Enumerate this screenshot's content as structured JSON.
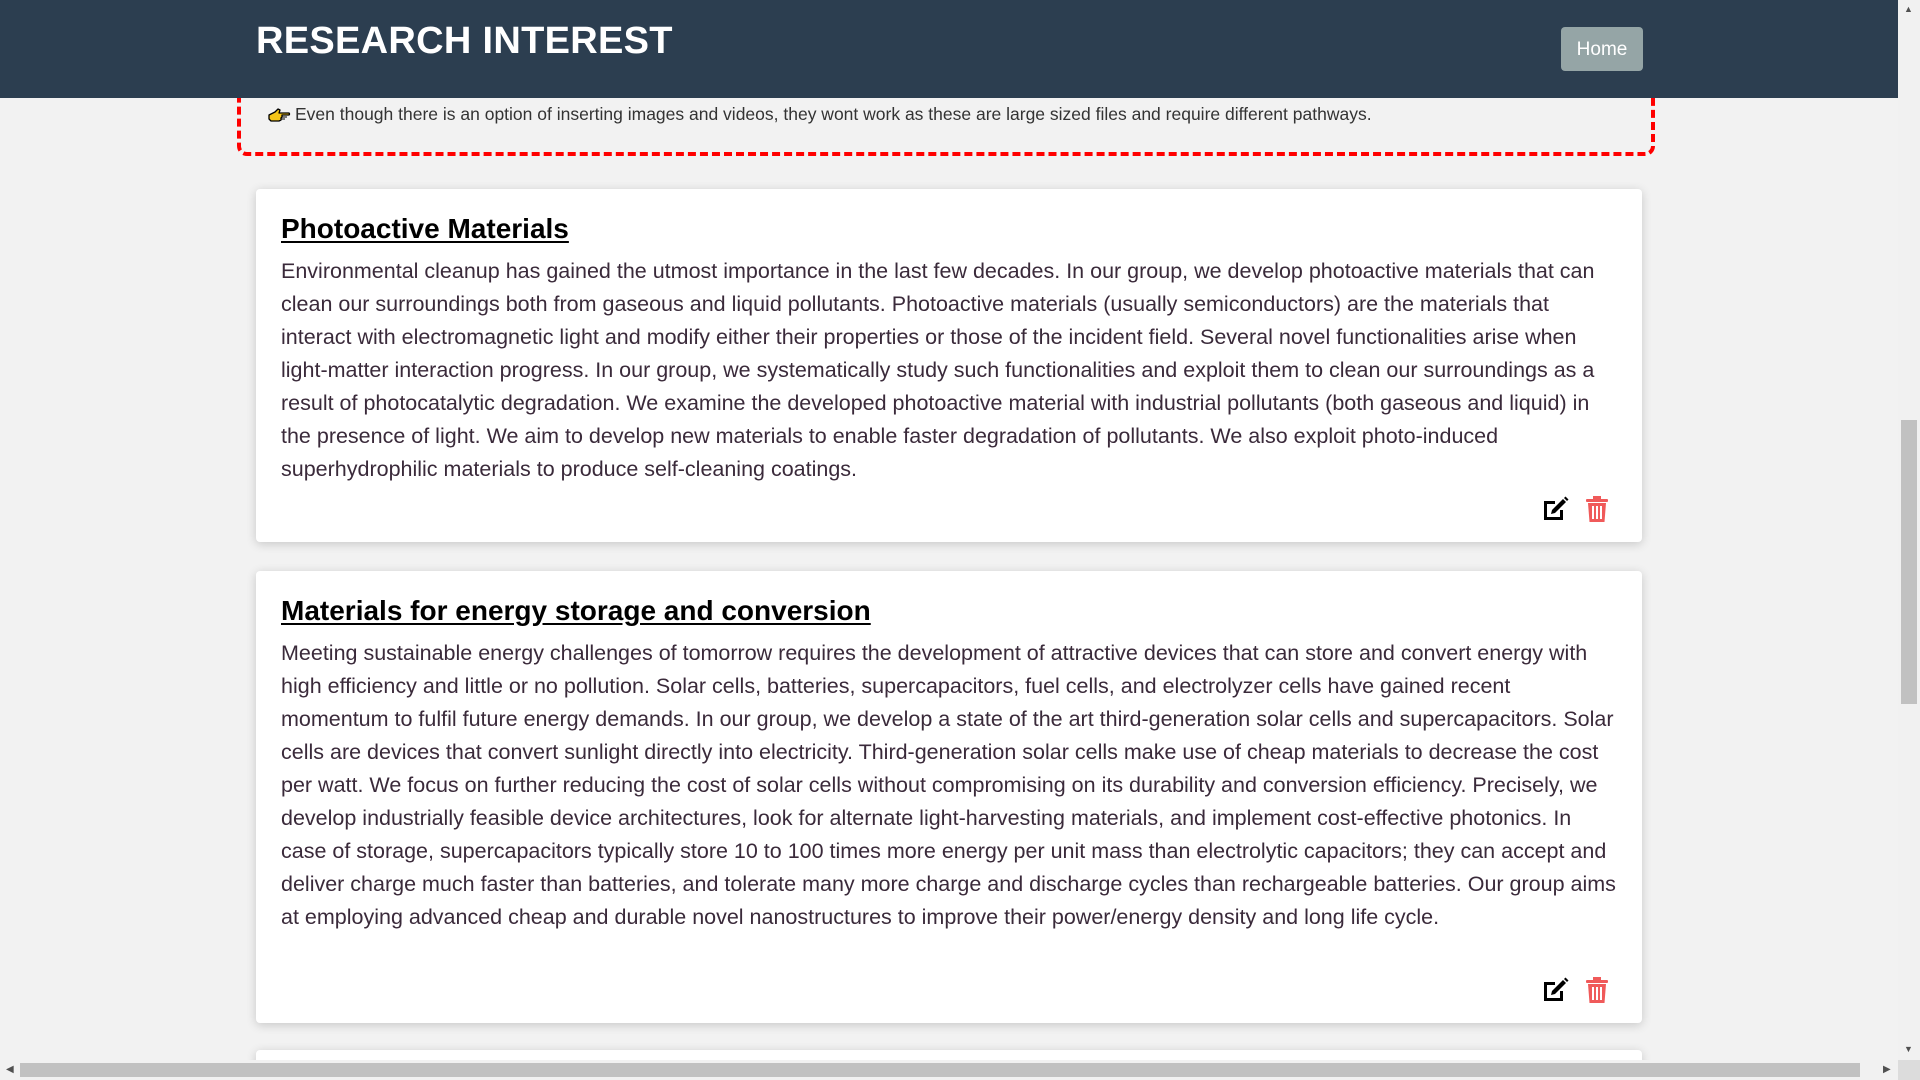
{
  "header": {
    "title": "RESEARCH INTEREST",
    "home_label": "Home",
    "background": "#2c3e50",
    "button_color": "#95a5a6"
  },
  "notice": {
    "text": "Even though there is an option of inserting images and videos, they wont work as these are large sized files and require different pathways.",
    "icon": "pointing-hand-icon",
    "border_color": "#ff0000"
  },
  "cards": [
    {
      "title": "Photoactive Materials",
      "body": "Environmental cleanup has gained the utmost importance in the last few decades. In our group, we develop photoactive materials that can clean our surroundings both from gaseous and liquid pollutants. Photoactive materials (usually semiconductors) are the materials that interact with electromagnetic light and modify either their properties or those of the incident field. Several novel functionalities arise when light-matter interaction progress. In our group, we systematically study such functionalities and exploit them to clean our surroundings as a result of photocatalytic degradation. We examine the developed photoactive material with industrial pollutants (both gaseous and liquid) in the presence of light. We aim to develop new materials to enable faster degradation of pollutants. We also exploit photo-induced superhydrophilic materials to produce self-cleaning coatings.",
      "actions": [
        "edit-icon",
        "trash-icon"
      ]
    },
    {
      "title": "Materials for energy storage and conversion",
      "body": "Meeting sustainable energy challenges of tomorrow requires the development of attractive devices that can store and convert energy with high efficiency and little or no pollution. Solar cells, batteries, supercapacitors, fuel cells, and electrolyzer cells have gained recent momentum to fulfil future energy demands. In our group, we develop a state of the art third-generation solar cells and supercapacitors. Solar cells are devices that convert sunlight directly into electricity. Third-generation solar cells make use of cheap materials to decrease the cost per watt. We focus on further reducing the cost of solar cells without compromising on its durability and conversion efficiency. Precisely, we develop industrially feasible device architectures, look for alternate light-harvesting materials, and implement cost-effective photonics. In case of storage, supercapacitors typically store 10 to 100 times more energy per unit mass than electrolytic capacitors; they can accept and deliver charge much faster than batteries, and tolerate many more charge and discharge cycles than rechargeable batteries. Our group aims at employing advanced cheap and durable novel nanostructures to improve their power/energy density and long life cycle.",
      "actions": [
        "edit-icon",
        "trash-icon"
      ]
    }
  ],
  "colors": {
    "page_background": "#f2f2f2",
    "delete_icon": "#f05a5a",
    "edit_icon": "#000000"
  }
}
